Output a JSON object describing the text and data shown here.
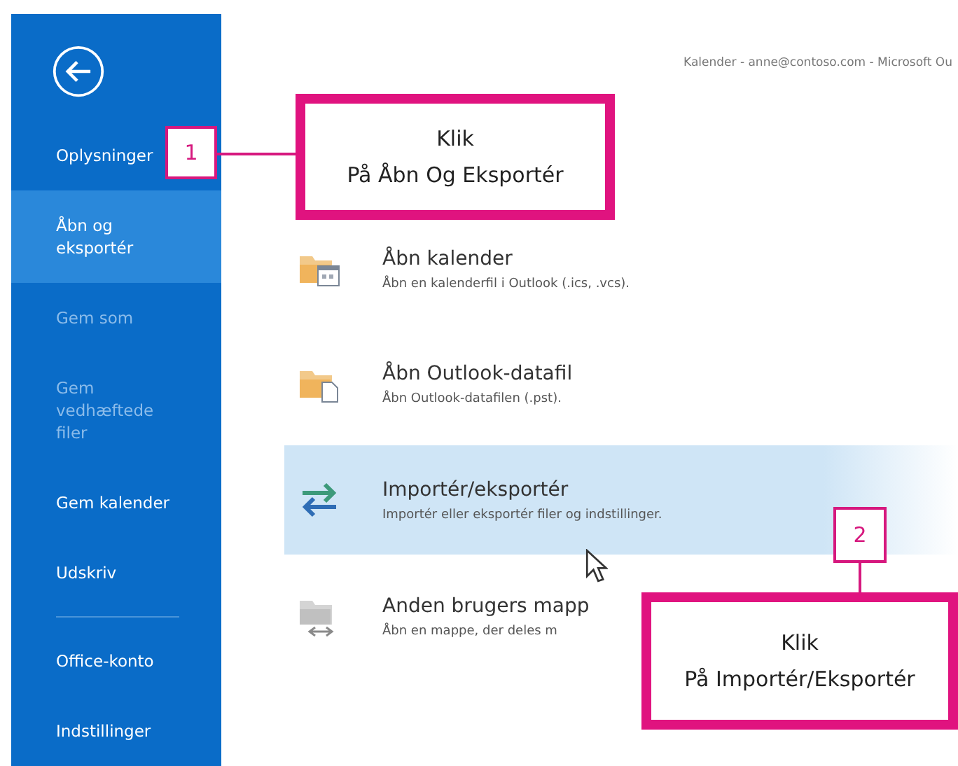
{
  "sidebar": {
    "items": [
      {
        "kind": "item",
        "label": "Oplysninger",
        "selected": false,
        "disabled": false
      },
      {
        "kind": "item",
        "label": "Åbn og eksportér",
        "selected": true,
        "disabled": false
      },
      {
        "kind": "item",
        "label": "Gem som",
        "selected": false,
        "disabled": true
      },
      {
        "kind": "item",
        "label": "Gem vedhæftede filer",
        "selected": false,
        "disabled": true
      },
      {
        "kind": "item",
        "label": "Gem kalender",
        "selected": false,
        "disabled": false
      },
      {
        "kind": "item",
        "label": "Udskriv",
        "selected": false,
        "disabled": false
      },
      {
        "kind": "divider"
      },
      {
        "kind": "item",
        "label": "Office-konto",
        "selected": false,
        "disabled": false
      },
      {
        "kind": "item",
        "label": "Indstillinger",
        "selected": false,
        "disabled": false
      }
    ]
  },
  "window": {
    "title": "Kalender - anne@contoso.com - Microsoft Ou"
  },
  "options": [
    {
      "title": "Åbn kalender",
      "description": "Åbn en kalenderfil i Outlook (.ics, .vcs).",
      "selected": false
    },
    {
      "title": "Åbn Outlook-datafil",
      "description": "Åbn Outlook-datafilen (.pst).",
      "selected": false
    },
    {
      "title": "Importér/eksportér",
      "description": "Importér eller eksportér filer og indstillinger.",
      "selected": true
    },
    {
      "title": "Anden brugers mapp",
      "description": "Åbn en mappe, der deles m",
      "selected": false
    }
  ],
  "callouts": [
    {
      "number": "1",
      "lines": [
        "Klik",
        "På Åbn Og Eksportér"
      ]
    },
    {
      "number": "2",
      "lines": [
        "Klik",
        "På Importér/Eksportér"
      ]
    }
  ]
}
